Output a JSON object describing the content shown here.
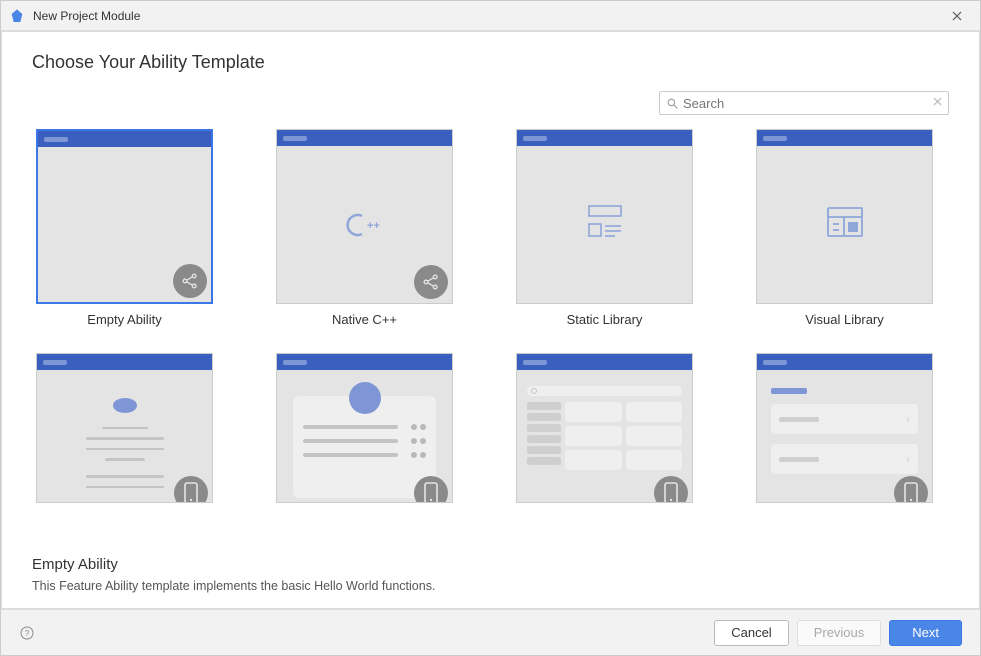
{
  "window": {
    "title": "New Project Module"
  },
  "page": {
    "heading": "Choose Your Ability Template"
  },
  "search": {
    "placeholder": "Search",
    "value": ""
  },
  "templates": {
    "row1": [
      {
        "label": "Empty Ability",
        "icon": "empty",
        "badge": "share",
        "selected": true
      },
      {
        "label": "Native C++",
        "icon": "cpp",
        "badge": "share",
        "selected": false
      },
      {
        "label": "Static Library",
        "icon": "static-lib",
        "badge": null,
        "selected": false
      },
      {
        "label": "Visual Library",
        "icon": "visual-lib",
        "badge": null,
        "selected": false
      }
    ],
    "row2": [
      {
        "label": "",
        "icon": "about",
        "badge": "phone",
        "selected": false
      },
      {
        "label": "",
        "icon": "login",
        "badge": "phone",
        "selected": false
      },
      {
        "label": "",
        "icon": "gridview",
        "badge": "phone",
        "selected": false
      },
      {
        "label": "",
        "icon": "listview",
        "badge": "phone",
        "selected": false
      }
    ]
  },
  "description": {
    "title": "Empty Ability",
    "text": "This Feature Ability template implements the basic Hello World functions."
  },
  "footer": {
    "cancel_label": "Cancel",
    "previous_label": "Previous",
    "next_label": "Next",
    "previous_enabled": false
  }
}
